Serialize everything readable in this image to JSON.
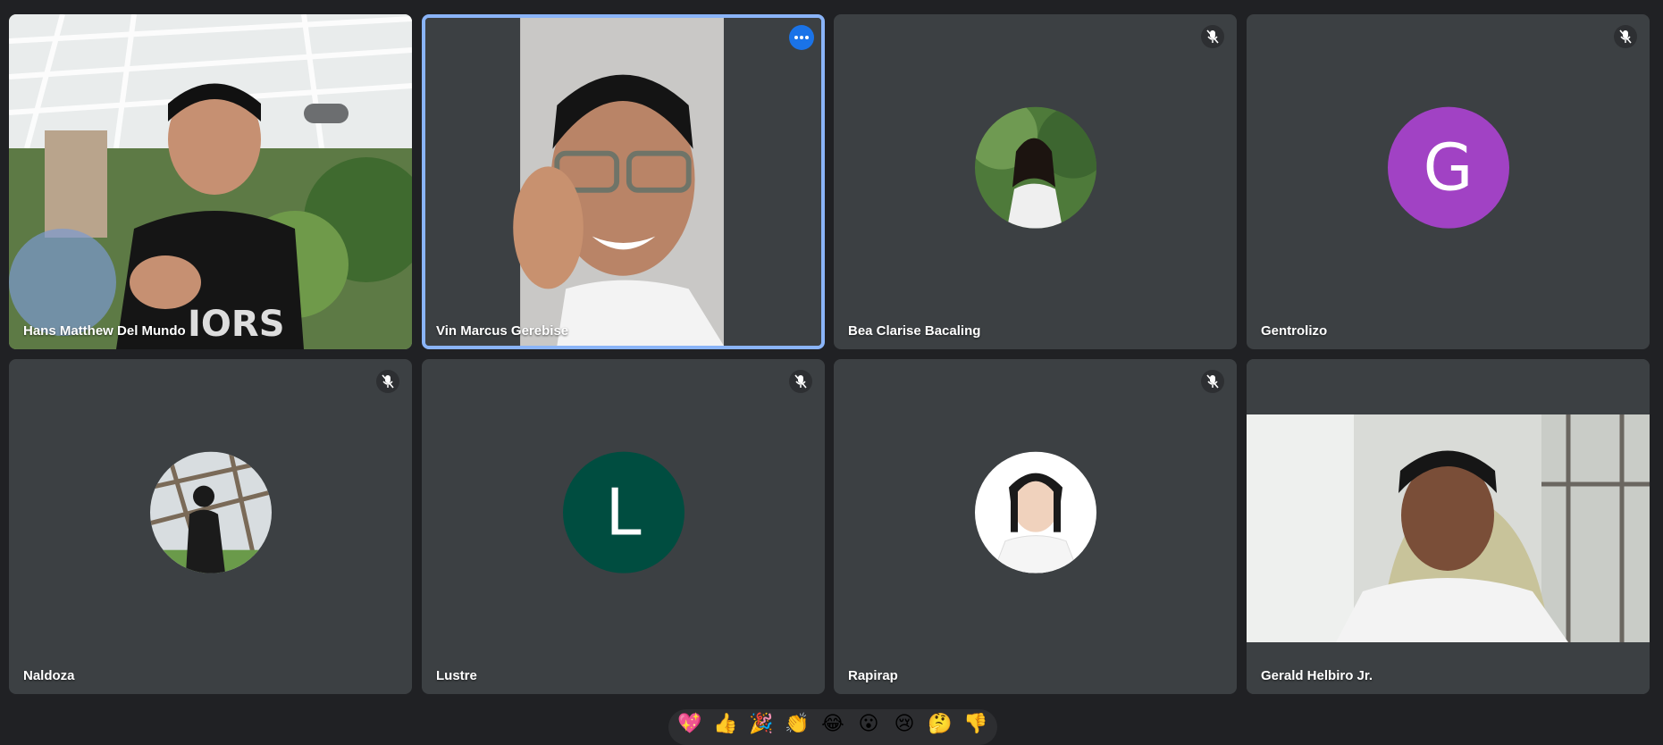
{
  "participants": [
    {
      "name": "Hans Matthew Del Mundo",
      "muted": false,
      "kind": "video"
    },
    {
      "name": "Vin Marcus Gerebise",
      "muted": false,
      "kind": "video",
      "active_speaker": true
    },
    {
      "name": "Bea Clarise Bacaling",
      "muted": true,
      "kind": "photo"
    },
    {
      "name": "Gentrolizo",
      "muted": true,
      "kind": "letter",
      "initial": "G",
      "color": "#a142c4"
    },
    {
      "name": "Naldoza",
      "muted": true,
      "kind": "photo"
    },
    {
      "name": "Lustre",
      "muted": true,
      "kind": "letter",
      "initial": "L",
      "color": "#004d40"
    },
    {
      "name": "Rapirap",
      "muted": true,
      "kind": "photo"
    },
    {
      "name": "Gerald Helbiro Jr.",
      "muted": false,
      "kind": "video"
    }
  ],
  "reactions": [
    "💖",
    "👍",
    "🎉",
    "👏",
    "😂",
    "😮",
    "😢",
    "🤔",
    "👎"
  ],
  "icons": {
    "mute": "mic-off-icon",
    "more": "more-options-icon"
  },
  "colors": {
    "background": "#202124",
    "tile": "#3c4043",
    "active_border": "#8ab4f8",
    "accent": "#1a73e8"
  }
}
